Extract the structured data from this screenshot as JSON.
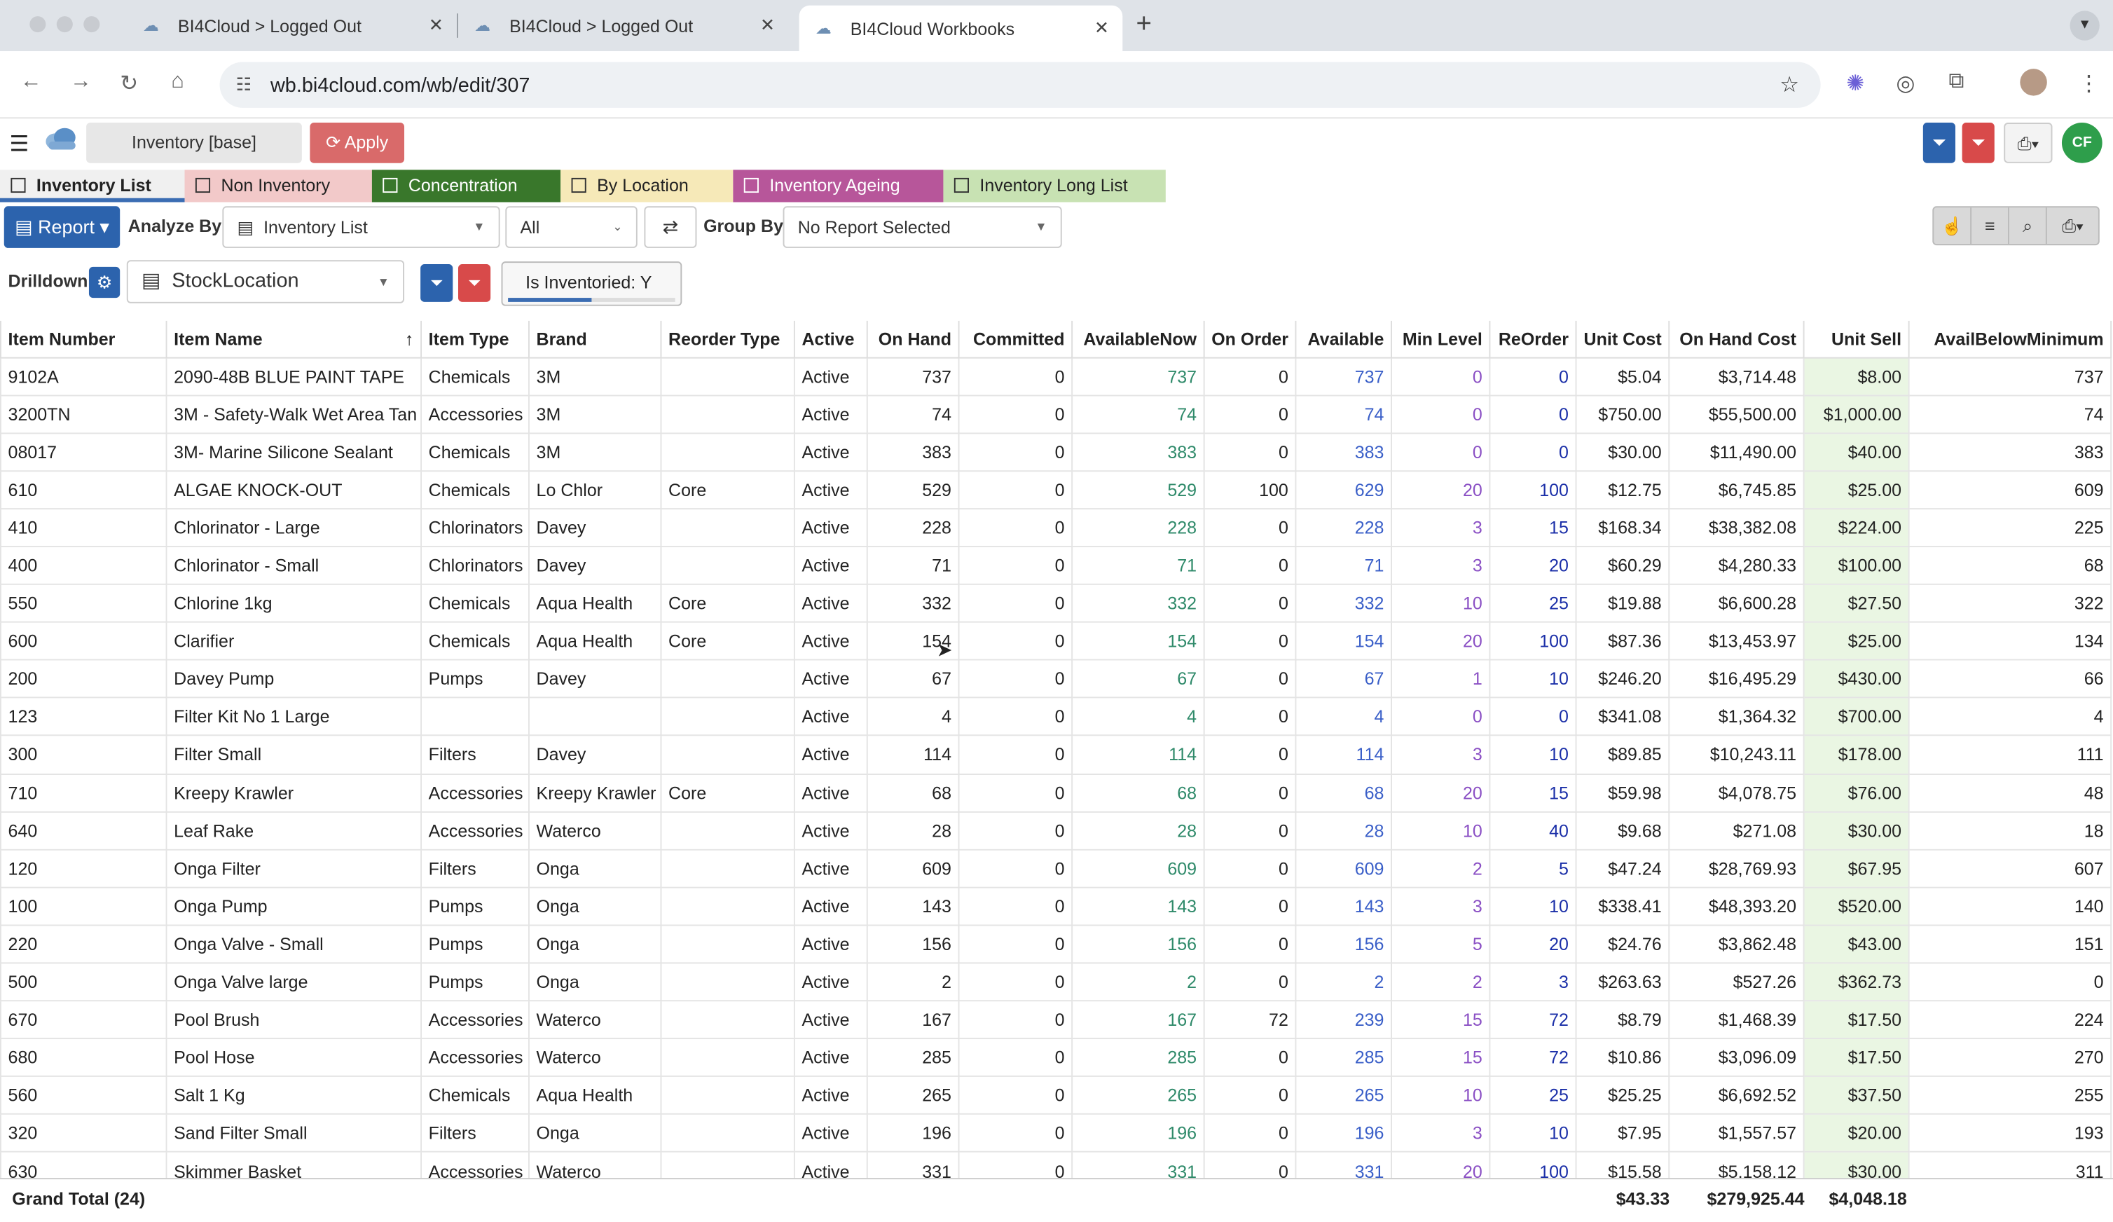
{
  "browser": {
    "tabs": [
      {
        "title": "BI4Cloud > Logged Out"
      },
      {
        "title": "BI4Cloud > Logged Out"
      },
      {
        "title": "BI4Cloud Workbooks"
      }
    ],
    "url": "wb.bi4cloud.com/wb/edit/307"
  },
  "app": {
    "workbook_name": "Inventory [base]",
    "apply_label": "Apply",
    "user_initials": "CF",
    "brand_color": "#2c63ad",
    "report_tabs": [
      {
        "label": "Inventory List",
        "color": "#f0f0f0"
      },
      {
        "label": "Non Inventory",
        "color": "#f2c9c9"
      },
      {
        "label": "Concentration",
        "color": "#39772b"
      },
      {
        "label": "By Location",
        "color": "#f6e9b8"
      },
      {
        "label": "Inventory Ageing",
        "color": "#b7569a"
      },
      {
        "label": "Inventory Long List",
        "color": "#c8e2b3"
      }
    ],
    "controls": {
      "report_label": "Report",
      "analyze_by_label": "Analyze By",
      "analyze_by_value": "Inventory List",
      "all_value": "All",
      "group_by_label": "Group By",
      "group_by_value": "No Report Selected",
      "drilldown_label": "Drilldown",
      "drilldown_value": "StockLocation",
      "filter_chip": "Is Inventoried: Y"
    }
  },
  "table": {
    "columns": [
      "Item Number",
      "Item Name",
      "Item Type",
      "Brand",
      "Reorder Type",
      "Active",
      "On Hand",
      "Committed",
      "AvailableNow",
      "On Order",
      "Available",
      "Min Level",
      "ReOrder",
      "Unit Cost",
      "On Hand Cost",
      "Unit Sell",
      "AvailBelowMinimum"
    ],
    "rows": [
      [
        "9102A",
        "2090-48B BLUE PAINT TAPE",
        "Chemicals",
        "3M",
        "",
        "Active",
        "737",
        "0",
        "737",
        "0",
        "737",
        "0",
        "0",
        "$5.04",
        "$3,714.48",
        "$8.00",
        "737"
      ],
      [
        "3200TN",
        "3M - Safety-Walk Wet Area Tan",
        "Accessories",
        "3M",
        "",
        "Active",
        "74",
        "0",
        "74",
        "0",
        "74",
        "0",
        "0",
        "$750.00",
        "$55,500.00",
        "$1,000.00",
        "74"
      ],
      [
        "08017",
        "3M- Marine Silicone Sealant",
        "Chemicals",
        "3M",
        "",
        "Active",
        "383",
        "0",
        "383",
        "0",
        "383",
        "0",
        "0",
        "$30.00",
        "$11,490.00",
        "$40.00",
        "383"
      ],
      [
        "610",
        "ALGAE KNOCK-OUT",
        "Chemicals",
        "Lo Chlor",
        "Core",
        "Active",
        "529",
        "0",
        "529",
        "100",
        "629",
        "20",
        "100",
        "$12.75",
        "$6,745.85",
        "$25.00",
        "609"
      ],
      [
        "410",
        "Chlorinator - Large",
        "Chlorinators",
        "Davey",
        "",
        "Active",
        "228",
        "0",
        "228",
        "0",
        "228",
        "3",
        "15",
        "$168.34",
        "$38,382.08",
        "$224.00",
        "225"
      ],
      [
        "400",
        "Chlorinator - Small",
        "Chlorinators",
        "Davey",
        "",
        "Active",
        "71",
        "0",
        "71",
        "0",
        "71",
        "3",
        "20",
        "$60.29",
        "$4,280.33",
        "$100.00",
        "68"
      ],
      [
        "550",
        "Chlorine 1kg",
        "Chemicals",
        "Aqua Health",
        "Core",
        "Active",
        "332",
        "0",
        "332",
        "0",
        "332",
        "10",
        "25",
        "$19.88",
        "$6,600.28",
        "$27.50",
        "322"
      ],
      [
        "600",
        "Clarifier",
        "Chemicals",
        "Aqua Health",
        "Core",
        "Active",
        "154",
        "0",
        "154",
        "0",
        "154",
        "20",
        "100",
        "$87.36",
        "$13,453.97",
        "$25.00",
        "134"
      ],
      [
        "200",
        "Davey Pump",
        "Pumps",
        "Davey",
        "",
        "Active",
        "67",
        "0",
        "67",
        "0",
        "67",
        "1",
        "10",
        "$246.20",
        "$16,495.29",
        "$430.00",
        "66"
      ],
      [
        "123",
        "Filter Kit No 1 Large",
        "",
        "",
        "",
        "Active",
        "4",
        "0",
        "4",
        "0",
        "4",
        "0",
        "0",
        "$341.08",
        "$1,364.32",
        "$700.00",
        "4"
      ],
      [
        "300",
        "Filter Small",
        "Filters",
        "Davey",
        "",
        "Active",
        "114",
        "0",
        "114",
        "0",
        "114",
        "3",
        "10",
        "$89.85",
        "$10,243.11",
        "$178.00",
        "111"
      ],
      [
        "710",
        "Kreepy Krawler",
        "Accessories",
        "Kreepy Krawler",
        "Core",
        "Active",
        "68",
        "0",
        "68",
        "0",
        "68",
        "20",
        "15",
        "$59.98",
        "$4,078.75",
        "$76.00",
        "48"
      ],
      [
        "640",
        "Leaf Rake",
        "Accessories",
        "Waterco",
        "",
        "Active",
        "28",
        "0",
        "28",
        "0",
        "28",
        "10",
        "40",
        "$9.68",
        "$271.08",
        "$30.00",
        "18"
      ],
      [
        "120",
        "Onga Filter",
        "Filters",
        "Onga",
        "",
        "Active",
        "609",
        "0",
        "609",
        "0",
        "609",
        "2",
        "5",
        "$47.24",
        "$28,769.93",
        "$67.95",
        "607"
      ],
      [
        "100",
        "Onga Pump",
        "Pumps",
        "Onga",
        "",
        "Active",
        "143",
        "0",
        "143",
        "0",
        "143",
        "3",
        "10",
        "$338.41",
        "$48,393.20",
        "$520.00",
        "140"
      ],
      [
        "220",
        "Onga Valve - Small",
        "Pumps",
        "Onga",
        "",
        "Active",
        "156",
        "0",
        "156",
        "0",
        "156",
        "5",
        "20",
        "$24.76",
        "$3,862.48",
        "$43.00",
        "151"
      ],
      [
        "500",
        "Onga Valve large",
        "Pumps",
        "Onga",
        "",
        "Active",
        "2",
        "0",
        "2",
        "0",
        "2",
        "2",
        "3",
        "$263.63",
        "$527.26",
        "$362.73",
        "0"
      ],
      [
        "670",
        "Pool Brush",
        "Accessories",
        "Waterco",
        "",
        "Active",
        "167",
        "0",
        "167",
        "72",
        "239",
        "15",
        "72",
        "$8.79",
        "$1,468.39",
        "$17.50",
        "224"
      ],
      [
        "680",
        "Pool Hose",
        "Accessories",
        "Waterco",
        "",
        "Active",
        "285",
        "0",
        "285",
        "0",
        "285",
        "15",
        "72",
        "$10.86",
        "$3,096.09",
        "$17.50",
        "270"
      ],
      [
        "560",
        "Salt 1 Kg",
        "Chemicals",
        "Aqua Health",
        "",
        "Active",
        "265",
        "0",
        "265",
        "0",
        "265",
        "10",
        "25",
        "$25.25",
        "$6,692.52",
        "$37.50",
        "255"
      ],
      [
        "320",
        "Sand Filter Small",
        "Filters",
        "Onga",
        "",
        "Active",
        "196",
        "0",
        "196",
        "0",
        "196",
        "3",
        "10",
        "$7.95",
        "$1,557.57",
        "$20.00",
        "193"
      ],
      [
        "630",
        "Skimmer Basket",
        "Accessories",
        "Waterco",
        "",
        "Active",
        "331",
        "0",
        "331",
        "0",
        "331",
        "20",
        "100",
        "$15.58",
        "$5,158.12",
        "$30.00",
        "311"
      ]
    ],
    "totals": {
      "label": "Grand Total (24)",
      "unit_cost": "$43.33",
      "on_hand_cost": "$279,925.44",
      "unit_sell": "$4,048.18"
    }
  }
}
